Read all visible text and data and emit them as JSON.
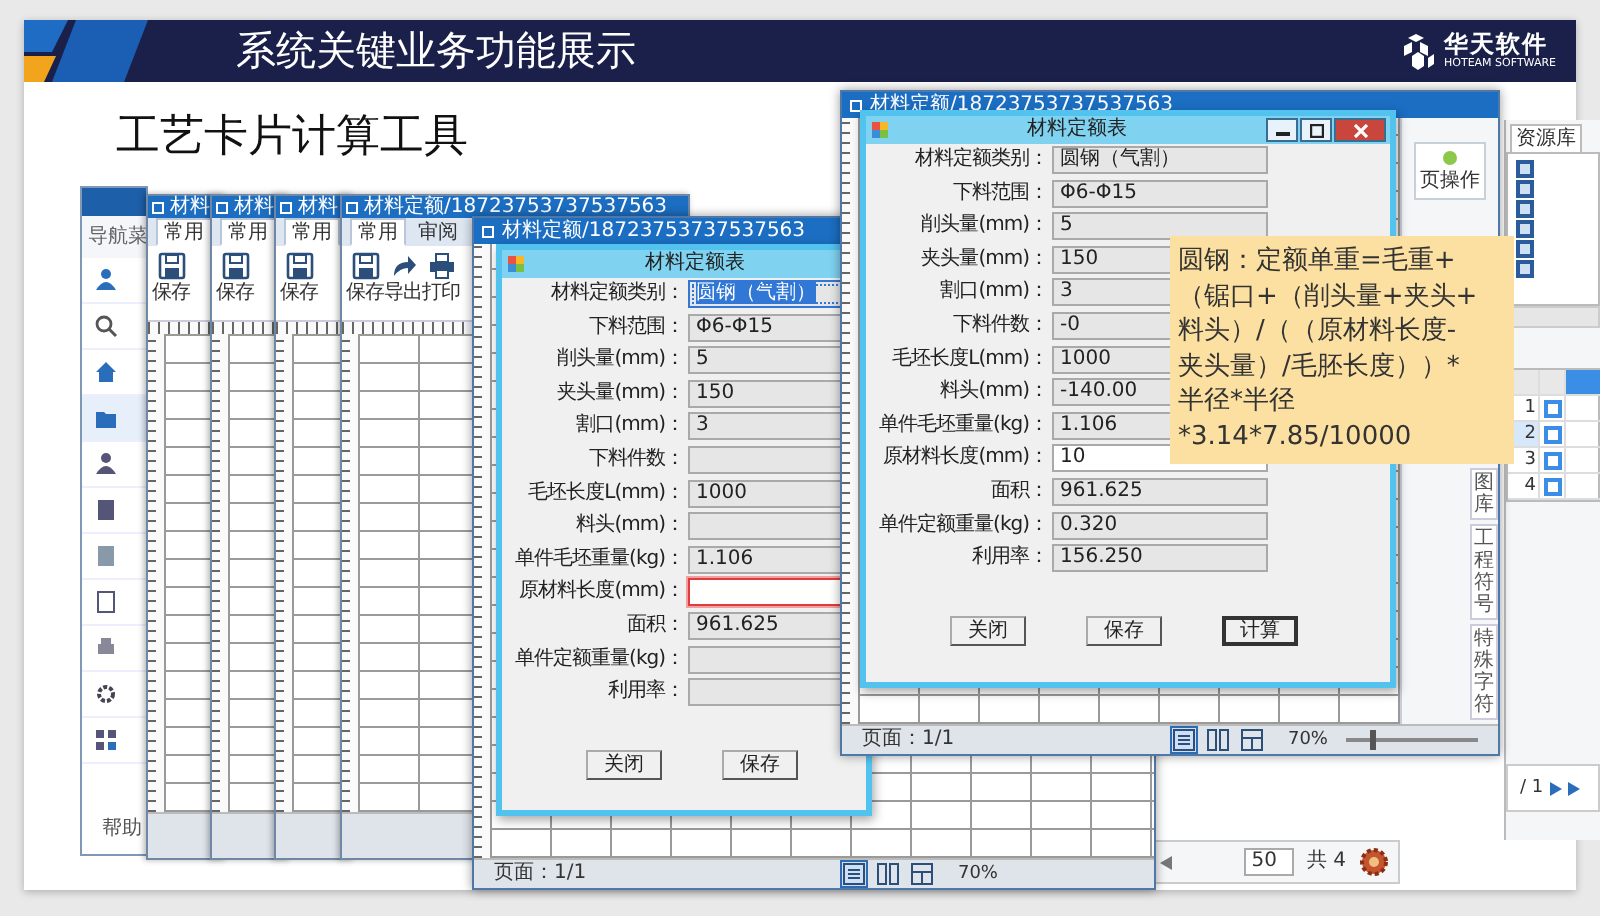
{
  "slide": {
    "title": "系统关键业务功能展示",
    "logo_name": "华天软件",
    "logo_tagline": "HOTEAM SOFTWARE",
    "heading": "工艺卡片计算工具"
  },
  "nav_window": {
    "menu_title": "导航菜",
    "footer": "帮助"
  },
  "doc_windows": [
    {
      "title": "材料",
      "tabs": [
        {
          "label": "常用",
          "selected": true
        }
      ],
      "tools": [
        {
          "label": "保存",
          "kind": "save"
        }
      ]
    },
    {
      "title": "材料",
      "tabs": [
        {
          "label": "常用",
          "selected": true
        }
      ],
      "tools": [
        {
          "label": "保存",
          "kind": "save"
        }
      ]
    },
    {
      "title": "材料",
      "tabs": [
        {
          "label": "常用",
          "selected": true
        }
      ],
      "tools": [
        {
          "label": "保存",
          "kind": "save"
        }
      ]
    },
    {
      "title": "材料定额/18723753737537563",
      "tabs": [
        {
          "label": "常用",
          "selected": true
        },
        {
          "label": "审阅",
          "selected": false
        }
      ],
      "tools": [
        {
          "label": "保存",
          "kind": "save"
        },
        {
          "label": "导出",
          "kind": "export"
        },
        {
          "label": "打印",
          "kind": "print"
        }
      ]
    }
  ],
  "form_windows": [
    {
      "window_title": "材料定额/18723753737537563",
      "dialog_title": "材料定额表",
      "window_controls": false,
      "fields": [
        {
          "label": "材料定额类别：",
          "value": "圆钢（气割）",
          "selected": true,
          "error": false,
          "editable": false
        },
        {
          "label": "下料范围：",
          "value": "Φ6-Φ15",
          "selected": false,
          "error": false,
          "editable": false
        },
        {
          "label": "削头量(mm)：",
          "value": "5",
          "selected": false,
          "error": false,
          "editable": false
        },
        {
          "label": "夹头量(mm)：",
          "value": "150",
          "selected": false,
          "error": false,
          "editable": false
        },
        {
          "label": "割口(mm)：",
          "value": "3",
          "selected": false,
          "error": false,
          "editable": false
        },
        {
          "label": "下料件数：",
          "selected": false,
          "error": false,
          "editable": false
        },
        {
          "label": "毛坯长度L(mm)：",
          "value": "1000",
          "selected": false,
          "error": false,
          "editable": false
        },
        {
          "label": "料头(mm)：",
          "selected": false,
          "error": false,
          "editable": false
        },
        {
          "label": "单件毛坯重量(kg)：",
          "value": "1.106",
          "selected": false,
          "error": false,
          "editable": false
        },
        {
          "label": "原材料长度(mm)：",
          "selected": false,
          "error": true,
          "editable": true
        },
        {
          "label": "面积：",
          "value": "961.625",
          "selected": false,
          "error": false,
          "editable": false
        },
        {
          "label": "单件定额重量(kg)：",
          "selected": false,
          "error": false,
          "editable": false
        },
        {
          "label": "利用率：",
          "selected": false,
          "error": false,
          "editable": false
        }
      ],
      "buttons": [
        {
          "label": "关闭",
          "focused": false
        },
        {
          "label": "保存",
          "focused": false
        }
      ],
      "footer": "页面：1/1",
      "view_modes": [
        {
          "kind": "single",
          "selected": true
        },
        {
          "kind": "double",
          "selected": false
        },
        {
          "kind": "grid",
          "selected": false
        }
      ],
      "zoom": "70%"
    },
    {
      "window_title": "材料定额/18723753737537563",
      "dialog_title": "材料定额表",
      "window_controls": true,
      "fields": [
        {
          "label": "材料定额类别：",
          "value": "圆钢（气割）",
          "selected": false,
          "error": false,
          "editable": false
        },
        {
          "label": "下料范围：",
          "value": "Φ6-Φ15",
          "selected": false,
          "error": false,
          "editable": false
        },
        {
          "label": "削头量(mm)：",
          "value": "5",
          "selected": false,
          "error": false,
          "editable": false
        },
        {
          "label": "夹头量(mm)：",
          "value": "150",
          "selected": false,
          "error": false,
          "editable": false
        },
        {
          "label": "割口(mm)：",
          "value": "3",
          "selected": false,
          "error": false,
          "editable": false
        },
        {
          "label": "下料件数：",
          "value": "-0",
          "selected": false,
          "error": false,
          "editable": false
        },
        {
          "label": "毛坯长度L(mm)：",
          "value": "1000",
          "selected": false,
          "error": false,
          "editable": false
        },
        {
          "label": "料头(mm)：",
          "value": "-140.00",
          "selected": false,
          "error": false,
          "editable": false
        },
        {
          "label": "单件毛坯重量(kg)：",
          "value": "1.106",
          "selected": false,
          "error": false,
          "editable": false
        },
        {
          "label": "原材料长度(mm)：",
          "value": "10",
          "selected": false,
          "error": false,
          "editable": true
        },
        {
          "label": "面积：",
          "value": "961.625",
          "selected": false,
          "error": false,
          "editable": false
        },
        {
          "label": "单件定额重量(kg)：",
          "value": "0.320",
          "selected": false,
          "error": false,
          "editable": false
        },
        {
          "label": "利用率：",
          "value": "156.250",
          "selected": false,
          "error": false,
          "editable": false
        }
      ],
      "buttons": [
        {
          "label": "关闭",
          "focused": false
        },
        {
          "label": "保存",
          "focused": false
        },
        {
          "label": "计算",
          "focused": true
        }
      ],
      "side_button": "页操作",
      "side_tabs": [
        "图库",
        "工程符号",
        "特殊字符"
      ],
      "footer": "页面：1/1",
      "view_modes": [
        {
          "kind": "single",
          "selected": true
        },
        {
          "kind": "double",
          "selected": false
        },
        {
          "kind": "grid",
          "selected": false
        }
      ],
      "zoom": "70%",
      "zoom_slider": {
        "level": 0.2
      }
    }
  ],
  "callout": {
    "lines": [
      "圆钢：定额单重=毛重+",
      "（锯口+（削头量+夹头+",
      "料头）/（（原材料长度-",
      "夹头量）/毛胚长度））*",
      "半径*半径",
      "*3.14*7.85/10000"
    ]
  },
  "resource_panel": {
    "tab": "资源库",
    "grid_rows": [
      {
        "number": "1",
        "selected": false
      },
      {
        "number": "2",
        "selected": true
      },
      {
        "number": "3",
        "selected": false
      },
      {
        "number": "4",
        "selected": false
      }
    ],
    "page": "/ 1"
  },
  "pager": {
    "page_size": "50",
    "total": "共 4"
  }
}
